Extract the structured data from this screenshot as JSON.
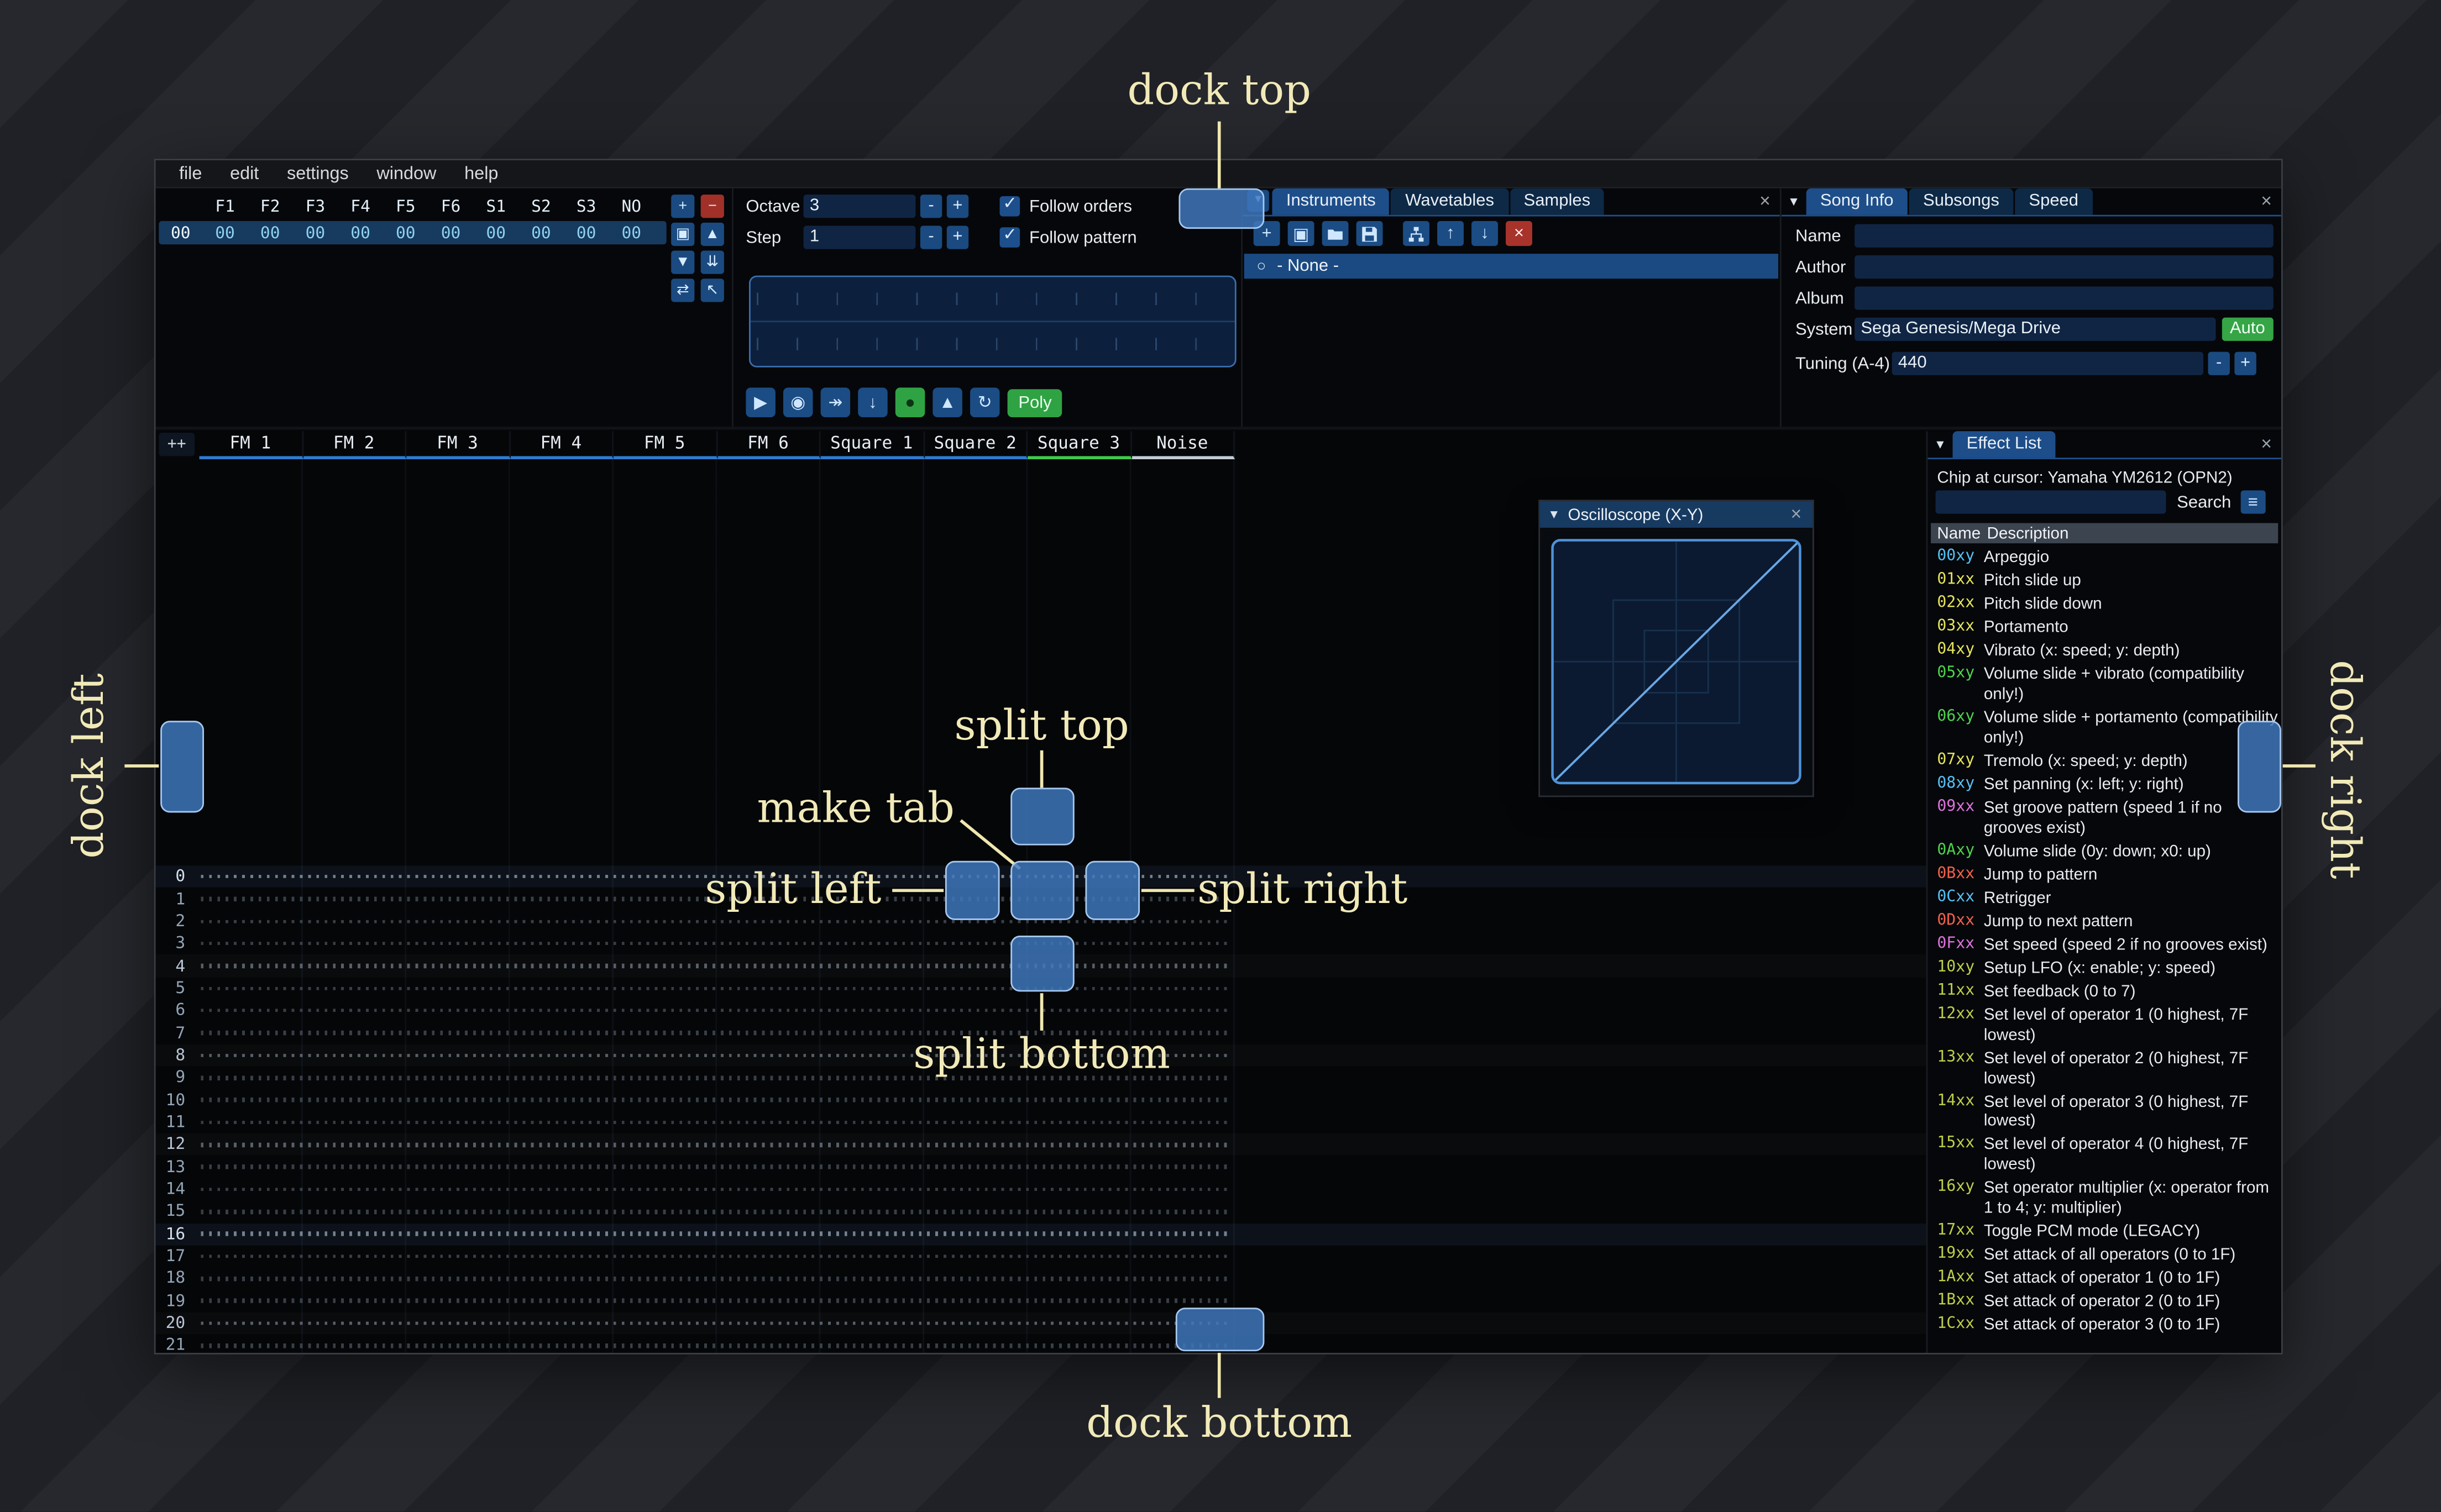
{
  "glyphs": {
    "check": "✓",
    "collapse": "▼",
    "close": "×",
    "hamburger": "≡",
    "radio": "○"
  },
  "colors": {
    "accent_blue": "#1d4e8a",
    "dock_highlight": "#4078be",
    "record_green": "#2fa344",
    "annotation": "#f1eab8"
  },
  "annotations": {
    "labels": {
      "dock_top": "dock top",
      "dock_bottom": "dock bottom",
      "dock_left": "dock left",
      "dock_right": "dock right",
      "split_top": "split top",
      "split_bottom": "split bottom",
      "split_left": "split left",
      "split_right": "split right",
      "make_tab": "make tab"
    }
  },
  "menu": {
    "items": [
      "file",
      "edit",
      "settings",
      "window",
      "help"
    ]
  },
  "orders": {
    "channel_headers": [
      "F1",
      "F2",
      "F3",
      "F4",
      "F5",
      "F6",
      "S1",
      "S2",
      "S3",
      "NO"
    ],
    "selected_row_index": "00",
    "selected_row_values": [
      "00",
      "00",
      "00",
      "00",
      "00",
      "00",
      "00",
      "00",
      "00",
      "00"
    ],
    "buttons": [
      {
        "name": "order-add-button",
        "icon": "plus-icon",
        "glyph": "+",
        "variant": "blue"
      },
      {
        "name": "order-remove-button",
        "icon": "minus-icon",
        "glyph": "−",
        "variant": "red"
      },
      {
        "name": "order-duplicate-button",
        "icon": "copy-icon",
        "glyph": "▣",
        "variant": "blue"
      },
      {
        "name": "order-move-up-button",
        "icon": "arrow-up-icon",
        "glyph": "▲",
        "variant": "blue"
      },
      {
        "name": "order-move-down-button",
        "icon": "arrow-down-icon",
        "glyph": "▼",
        "variant": "blue"
      },
      {
        "name": "order-duplicate-end-button",
        "icon": "double-down-icon",
        "glyph": "⇊",
        "variant": "blue"
      },
      {
        "name": "order-change-mode-button",
        "icon": "swap-icon",
        "glyph": "⇄",
        "variant": "blue"
      },
      {
        "name": "order-edit-mode-button",
        "icon": "cursor-icon",
        "glyph": "↖",
        "variant": "blue"
      }
    ]
  },
  "controls": {
    "octave_label": "Octave",
    "octave_value": "3",
    "step_label": "Step",
    "step_value": "1",
    "minus_label": "-",
    "plus_label": "+",
    "follow_orders_label": "Follow orders",
    "follow_pattern_label": "Follow pattern",
    "playback_buttons": [
      {
        "name": "play-button",
        "icon": "play-icon",
        "glyph": "▶"
      },
      {
        "name": "play-repeat-button",
        "icon": "play-circle-icon",
        "glyph": "◉"
      },
      {
        "name": "play-from-cursor-button",
        "icon": "skip-icon",
        "glyph": "↠"
      },
      {
        "name": "step-one-row-button",
        "icon": "step-down-icon",
        "glyph": "↓"
      },
      {
        "name": "edit-record-button",
        "icon": "record-icon",
        "glyph": "●",
        "variant": "green"
      },
      {
        "name": "metronome-button",
        "icon": "metronome-icon",
        "glyph": "▲"
      },
      {
        "name": "repeat-pattern-button",
        "icon": "repeat-icon",
        "glyph": "↻"
      }
    ],
    "poly_label": "Poly"
  },
  "instruments": {
    "tabs": [
      "Instruments",
      "Wavetables",
      "Samples"
    ],
    "toolbar": [
      {
        "name": "instrument-add-button",
        "icon": "plus-icon",
        "glyph": "+"
      },
      {
        "name": "instrument-duplicate-button",
        "icon": "copy-icon",
        "glyph": "▣"
      },
      {
        "name": "instrument-open-button",
        "icon": "folder-open-icon",
        "svg": "folder"
      },
      {
        "name": "instrument-save-button",
        "icon": "floppy-icon",
        "svg": "floppy"
      },
      {
        "name": "instrument-dir-toggle-button",
        "icon": "tree-icon",
        "svg": "tree"
      },
      {
        "name": "instrument-move-up-button",
        "icon": "arrow-up-icon",
        "glyph": "↑"
      },
      {
        "name": "instrument-move-down-button",
        "icon": "arrow-down-icon",
        "glyph": "↓"
      },
      {
        "name": "instrument-delete-button",
        "icon": "delete-icon",
        "glyph": "×",
        "variant": "red"
      }
    ],
    "selected_item": "- None -"
  },
  "song_info": {
    "tabs": [
      "Song Info",
      "Subsongs",
      "Speed"
    ],
    "name_label": "Name",
    "author_label": "Author",
    "album_label": "Album",
    "system_label": "System",
    "system_value": "Sega Genesis/Mega Drive",
    "auto_label": "Auto",
    "tuning_label": "Tuning (A-4)",
    "tuning_value": "440",
    "minus_label": "-",
    "plus_label": "+"
  },
  "pattern": {
    "corner_label": "++",
    "channels": [
      {
        "name": "FM 1",
        "color": "#2e7bd0"
      },
      {
        "name": "FM 2",
        "color": "#2e7bd0"
      },
      {
        "name": "FM 3",
        "color": "#2e7bd0"
      },
      {
        "name": "FM 4",
        "color": "#2e7bd0"
      },
      {
        "name": "FM 5",
        "color": "#2e7bd0"
      },
      {
        "name": "FM 6",
        "color": "#2e7bd0"
      },
      {
        "name": "Square 1",
        "color": "#2e7bd0"
      },
      {
        "name": "Square 2",
        "color": "#2e7bd0"
      },
      {
        "name": "Square 3",
        "color": "#3ecb4e"
      },
      {
        "name": "Noise",
        "color": "#c3ccd6"
      }
    ],
    "row_start": 0,
    "visible_rows": 22
  },
  "oscilloscope": {
    "title": "Oscilloscope (X-Y)"
  },
  "effect_list": {
    "title": "Effect List",
    "chip_line": "Chip at cursor: Yamaha YM2612 (OPN2)",
    "search_label": "Search",
    "name_column": "Name",
    "description_column": "Description",
    "effects": [
      {
        "code": "00xy",
        "color": "#55c1f5",
        "desc": "Arpeggio"
      },
      {
        "code": "01xx",
        "color": "#e5e55c",
        "desc": "Pitch slide up"
      },
      {
        "code": "02xx",
        "color": "#e5e55c",
        "desc": "Pitch slide down"
      },
      {
        "code": "03xx",
        "color": "#e5e55c",
        "desc": "Portamento"
      },
      {
        "code": "04xy",
        "color": "#e5e55c",
        "desc": "Vibrato (x: speed; y: depth)"
      },
      {
        "code": "05xy",
        "color": "#4cd44c",
        "desc": "Volume slide + vibrato (compatibility only!)"
      },
      {
        "code": "06xy",
        "color": "#4cd44c",
        "desc": "Volume slide + portamento (compatibility only!)"
      },
      {
        "code": "07xy",
        "color": "#e5e55c",
        "desc": "Tremolo (x: speed; y: depth)"
      },
      {
        "code": "08xy",
        "color": "#55c1f5",
        "desc": "Set panning (x: left; y: right)"
      },
      {
        "code": "09xx",
        "color": "#df72df",
        "desc": "Set groove pattern (speed 1 if no grooves exist)"
      },
      {
        "code": "0Axy",
        "color": "#4cd44c",
        "desc": "Volume slide (0y: down; x0: up)"
      },
      {
        "code": "0Bxx",
        "color": "#f2614d",
        "desc": "Jump to pattern"
      },
      {
        "code": "0Cxx",
        "color": "#55c1f5",
        "desc": "Retrigger"
      },
      {
        "code": "0Dxx",
        "color": "#f2614d",
        "desc": "Jump to next pattern"
      },
      {
        "code": "0Fxx",
        "color": "#df72df",
        "desc": "Set speed (speed 2 if no grooves exist)"
      },
      {
        "code": "10xy",
        "color": "#becf4b",
        "desc": "Setup LFO (x: enable; y: speed)"
      },
      {
        "code": "11xx",
        "color": "#becf4b",
        "desc": "Set feedback (0 to 7)"
      },
      {
        "code": "12xx",
        "color": "#becf4b",
        "desc": "Set level of operator 1 (0 highest, 7F lowest)"
      },
      {
        "code": "13xx",
        "color": "#becf4b",
        "desc": "Set level of operator 2 (0 highest, 7F lowest)"
      },
      {
        "code": "14xx",
        "color": "#becf4b",
        "desc": "Set level of operator 3 (0 highest, 7F lowest)"
      },
      {
        "code": "15xx",
        "color": "#becf4b",
        "desc": "Set level of operator 4 (0 highest, 7F lowest)"
      },
      {
        "code": "16xy",
        "color": "#becf4b",
        "desc": "Set operator multiplier (x: operator from 1 to 4; y: multiplier)"
      },
      {
        "code": "17xx",
        "color": "#becf4b",
        "desc": "Toggle PCM mode (LEGACY)"
      },
      {
        "code": "19xx",
        "color": "#becf4b",
        "desc": "Set attack of all operators (0 to 1F)"
      },
      {
        "code": "1Axx",
        "color": "#becf4b",
        "desc": "Set attack of operator 1 (0 to 1F)"
      },
      {
        "code": "1Bxx",
        "color": "#becf4b",
        "desc": "Set attack of operator 2 (0 to 1F)"
      },
      {
        "code": "1Cxx",
        "color": "#becf4b",
        "desc": "Set attack of operator 3 (0 to 1F)"
      }
    ]
  }
}
